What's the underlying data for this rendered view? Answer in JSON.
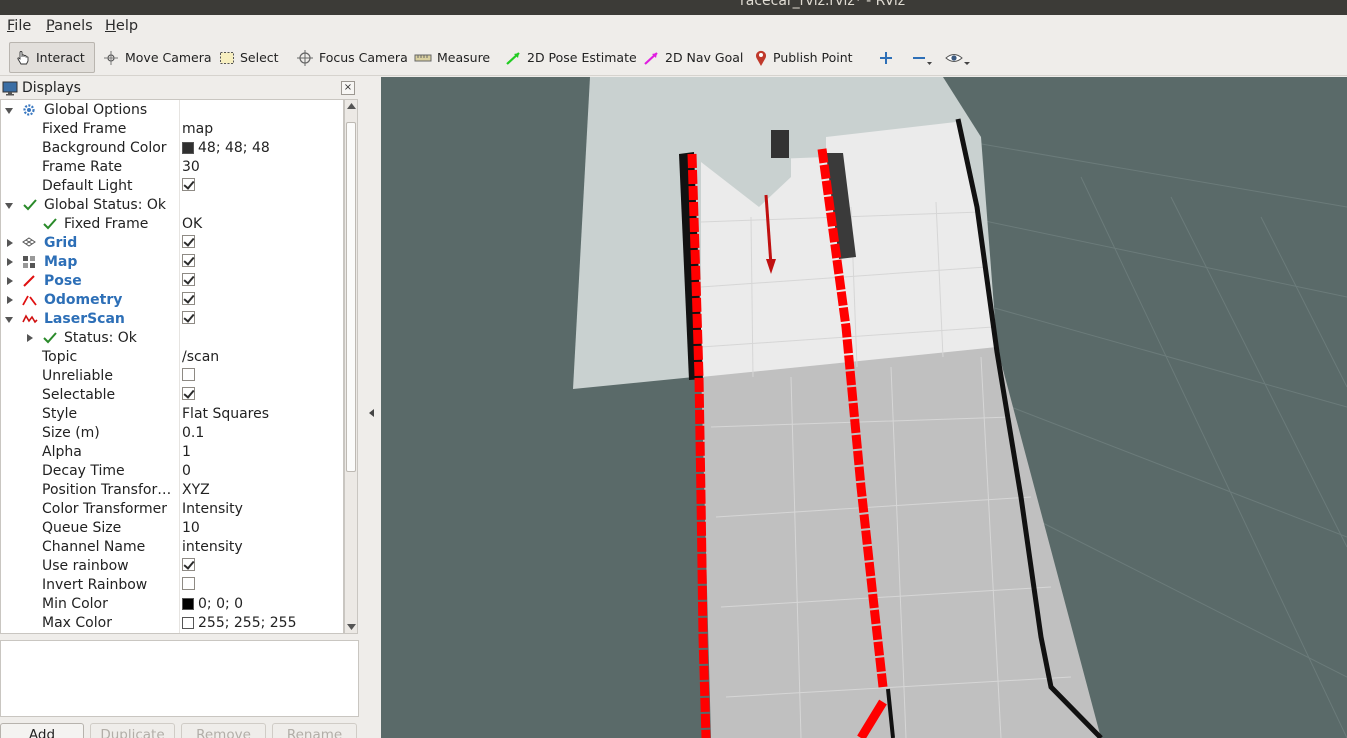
{
  "window": {
    "title": "racecar_rviz.rviz* - RViz"
  },
  "menu": {
    "file_first": "F",
    "file_rest": "ile",
    "panels_first": "P",
    "panels_rest": "anels",
    "help_first": "H",
    "help_rest": "elp"
  },
  "toolbar": {
    "interact": "Interact",
    "move_camera": "Move Camera",
    "select": "Select",
    "focus_camera": "Focus Camera",
    "measure": "Measure",
    "pose_estimate": "2D Pose Estimate",
    "nav_goal": "2D Nav Goal",
    "publish_point": "Publish Point"
  },
  "displays_panel": {
    "title": "Displays",
    "close": "×",
    "global_options": "Global Options",
    "fixed_frame_label": "Fixed Frame",
    "fixed_frame_value": "map",
    "background_color_label": "Background Color",
    "background_color_value": "48; 48; 48",
    "frame_rate_label": "Frame Rate",
    "frame_rate_value": "30",
    "default_light_label": "Default Light",
    "global_status": "Global Status: Ok",
    "status_fixed_frame_label": "Fixed Frame",
    "status_fixed_frame_value": "OK",
    "grid": "Grid",
    "map": "Map",
    "pose": "Pose",
    "odometry": "Odometry",
    "laserscan": "LaserScan",
    "laser_status": "Status: Ok",
    "topic_label": "Topic",
    "topic_value": "/scan",
    "unreliable_label": "Unreliable",
    "selectable_label": "Selectable",
    "style_label": "Style",
    "style_value": "Flat Squares",
    "size_label": "Size (m)",
    "size_value": "0.1",
    "alpha_label": "Alpha",
    "alpha_value": "1",
    "decay_label": "Decay Time",
    "decay_value": "0",
    "position_transformer_label": "Position Transfor…",
    "position_transformer_value": "XYZ",
    "color_transformer_label": "Color Transformer",
    "color_transformer_value": "Intensity",
    "queue_size_label": "Queue Size",
    "queue_size_value": "10",
    "channel_name_label": "Channel Name",
    "channel_name_value": "intensity",
    "use_rainbow_label": "Use rainbow",
    "invert_rainbow_label": "Invert Rainbow",
    "min_color_label": "Min Color",
    "min_color_value": "0; 0; 0",
    "max_color_label": "Max Color",
    "max_color_value": "255; 255; 255",
    "colors": {
      "background": "#303030",
      "min": "#000000",
      "max": "#ffffff",
      "link_blue": "#2d6fb7",
      "ok_green": "#2a8a2a"
    }
  },
  "buttons": {
    "add": "Add",
    "duplicate": "Duplicate",
    "remove": "Remove",
    "rename": "Rename"
  },
  "viewport": {
    "background_color": "#5a6a69",
    "scan_color": "#ff0000"
  }
}
